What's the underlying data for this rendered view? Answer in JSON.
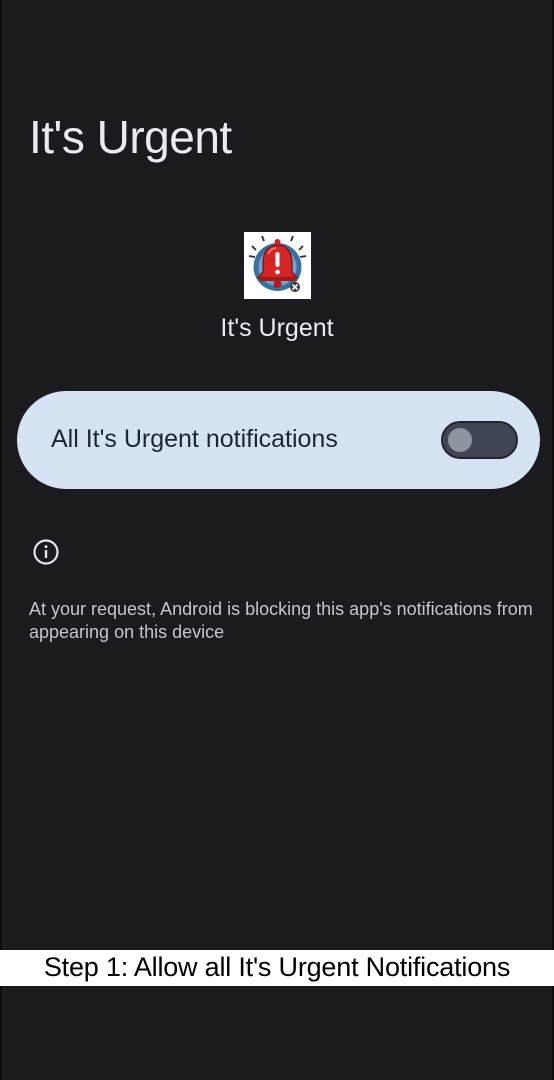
{
  "header": {
    "title": "It's Urgent"
  },
  "app": {
    "name": "It's Urgent",
    "icon": "alarm-bell-icon"
  },
  "notifications_toggle": {
    "label": "All It's Urgent notifications",
    "enabled": false
  },
  "info": {
    "icon": "info-icon",
    "text": "At your request, Android is blocking this app's notifications from appearing on this device"
  },
  "caption": {
    "text": "Step 1: Allow all It's Urgent Notifications"
  },
  "colors": {
    "background": "#1b1b1f",
    "card": "#d6e3f3",
    "switch_track": "#404553",
    "switch_thumb": "#8d939f"
  }
}
